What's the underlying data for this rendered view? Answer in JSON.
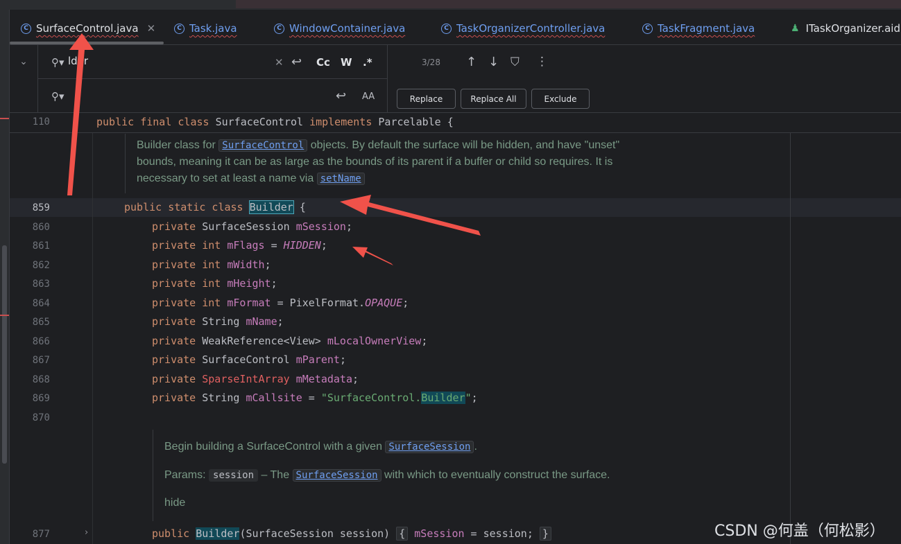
{
  "tabs": [
    {
      "label": "SurfaceControl.java",
      "active": true
    },
    {
      "label": "Task.java"
    },
    {
      "label": "WindowContainer.java"
    },
    {
      "label": "TaskOrganizerController.java"
    },
    {
      "label": "TaskFragment.java"
    },
    {
      "label": "ITaskOrganizer.aid"
    }
  ],
  "find": {
    "search_value": "lder",
    "case_label": "Cc",
    "word_label": "W",
    "regex_label": ".*",
    "match_count": "3/28",
    "replace_label": "Replace",
    "replace_all_label": "Replace All",
    "exclude_label": "Exclude",
    "preserve_case_label": "AA"
  },
  "sticky": {
    "line": "110",
    "code": "public final class SurfaceControl implements Parcelable {"
  },
  "doc1": {
    "t1": "Builder class for ",
    "link1": "SurfaceControl",
    "t2": " objects. By default the surface will be hidden, and have \"unset\"",
    "t3": "bounds, meaning it can be as large as the bounds of its parent if a buffer or child so requires. It is",
    "t4": "necessary to set at least a name via ",
    "link2": "setName"
  },
  "lines": {
    "l859": "859",
    "l860": "860",
    "l861": "861",
    "l862": "862",
    "l863": "863",
    "l864": "864",
    "l865": "865",
    "l866": "866",
    "l867": "867",
    "l868": "868",
    "l869": "869",
    "l870": "870",
    "l877": "877"
  },
  "doc2": {
    "t1": "Begin building a SurfaceControl with a given ",
    "link1": "SurfaceSession",
    "t1end": ".",
    "params_label": "Params: ",
    "param_name": "session",
    "t2": " – The ",
    "link2": "SurfaceSession",
    "t3": " with which to eventually construct the surface.",
    "hide": "hide"
  },
  "watermark": "CSDN @何盖（何松影）",
  "colors": {
    "keyword": "#cf8e6d",
    "field": "#c77dbb",
    "string": "#6aab73",
    "arrow": "#f0524a"
  }
}
